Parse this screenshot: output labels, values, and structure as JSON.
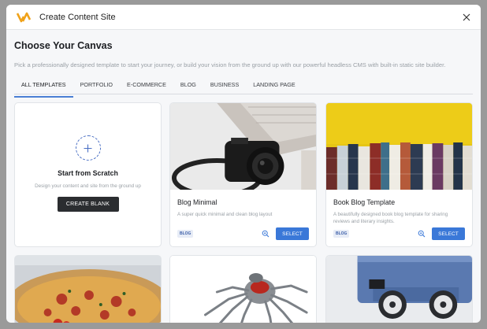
{
  "window": {
    "title": "Create Content Site"
  },
  "page": {
    "heading": "Choose Your Canvas",
    "subtitle": "Pick a professionally designed template to start your journey, or build your vision from the ground up with our powerful headless CMS with built-in static site builder."
  },
  "tabs": [
    {
      "label": "ALL TEMPLATES",
      "active": true
    },
    {
      "label": "PORTFOLIO"
    },
    {
      "label": "E-COMMERCE"
    },
    {
      "label": "BLOG"
    },
    {
      "label": "BUSINESS"
    },
    {
      "label": "LANDING PAGE"
    }
  ],
  "scratch": {
    "title": "Start from Scratch",
    "description": "Design your content and site from the ground up",
    "button": "CREATE BLANK"
  },
  "templates": [
    {
      "title": "Blog Minimal",
      "description": "A super quick minimal and clean blog layout",
      "tag": "BLOG",
      "button": "SELECT",
      "image": "camera-laptop-photo"
    },
    {
      "title": "Book Blog Template",
      "description": "A beautifully designed book blog template for sharing reviews and literary insights.",
      "tag": "BLOG",
      "button": "SELECT",
      "image": "books-photo"
    }
  ],
  "more_templates": [
    {
      "image": "pizza-photo"
    },
    {
      "image": "robot-spider-photo"
    },
    {
      "image": "suitcase-photo"
    }
  ],
  "colors": {
    "accent": "#3a78d8",
    "logo": "#f0a21a"
  }
}
